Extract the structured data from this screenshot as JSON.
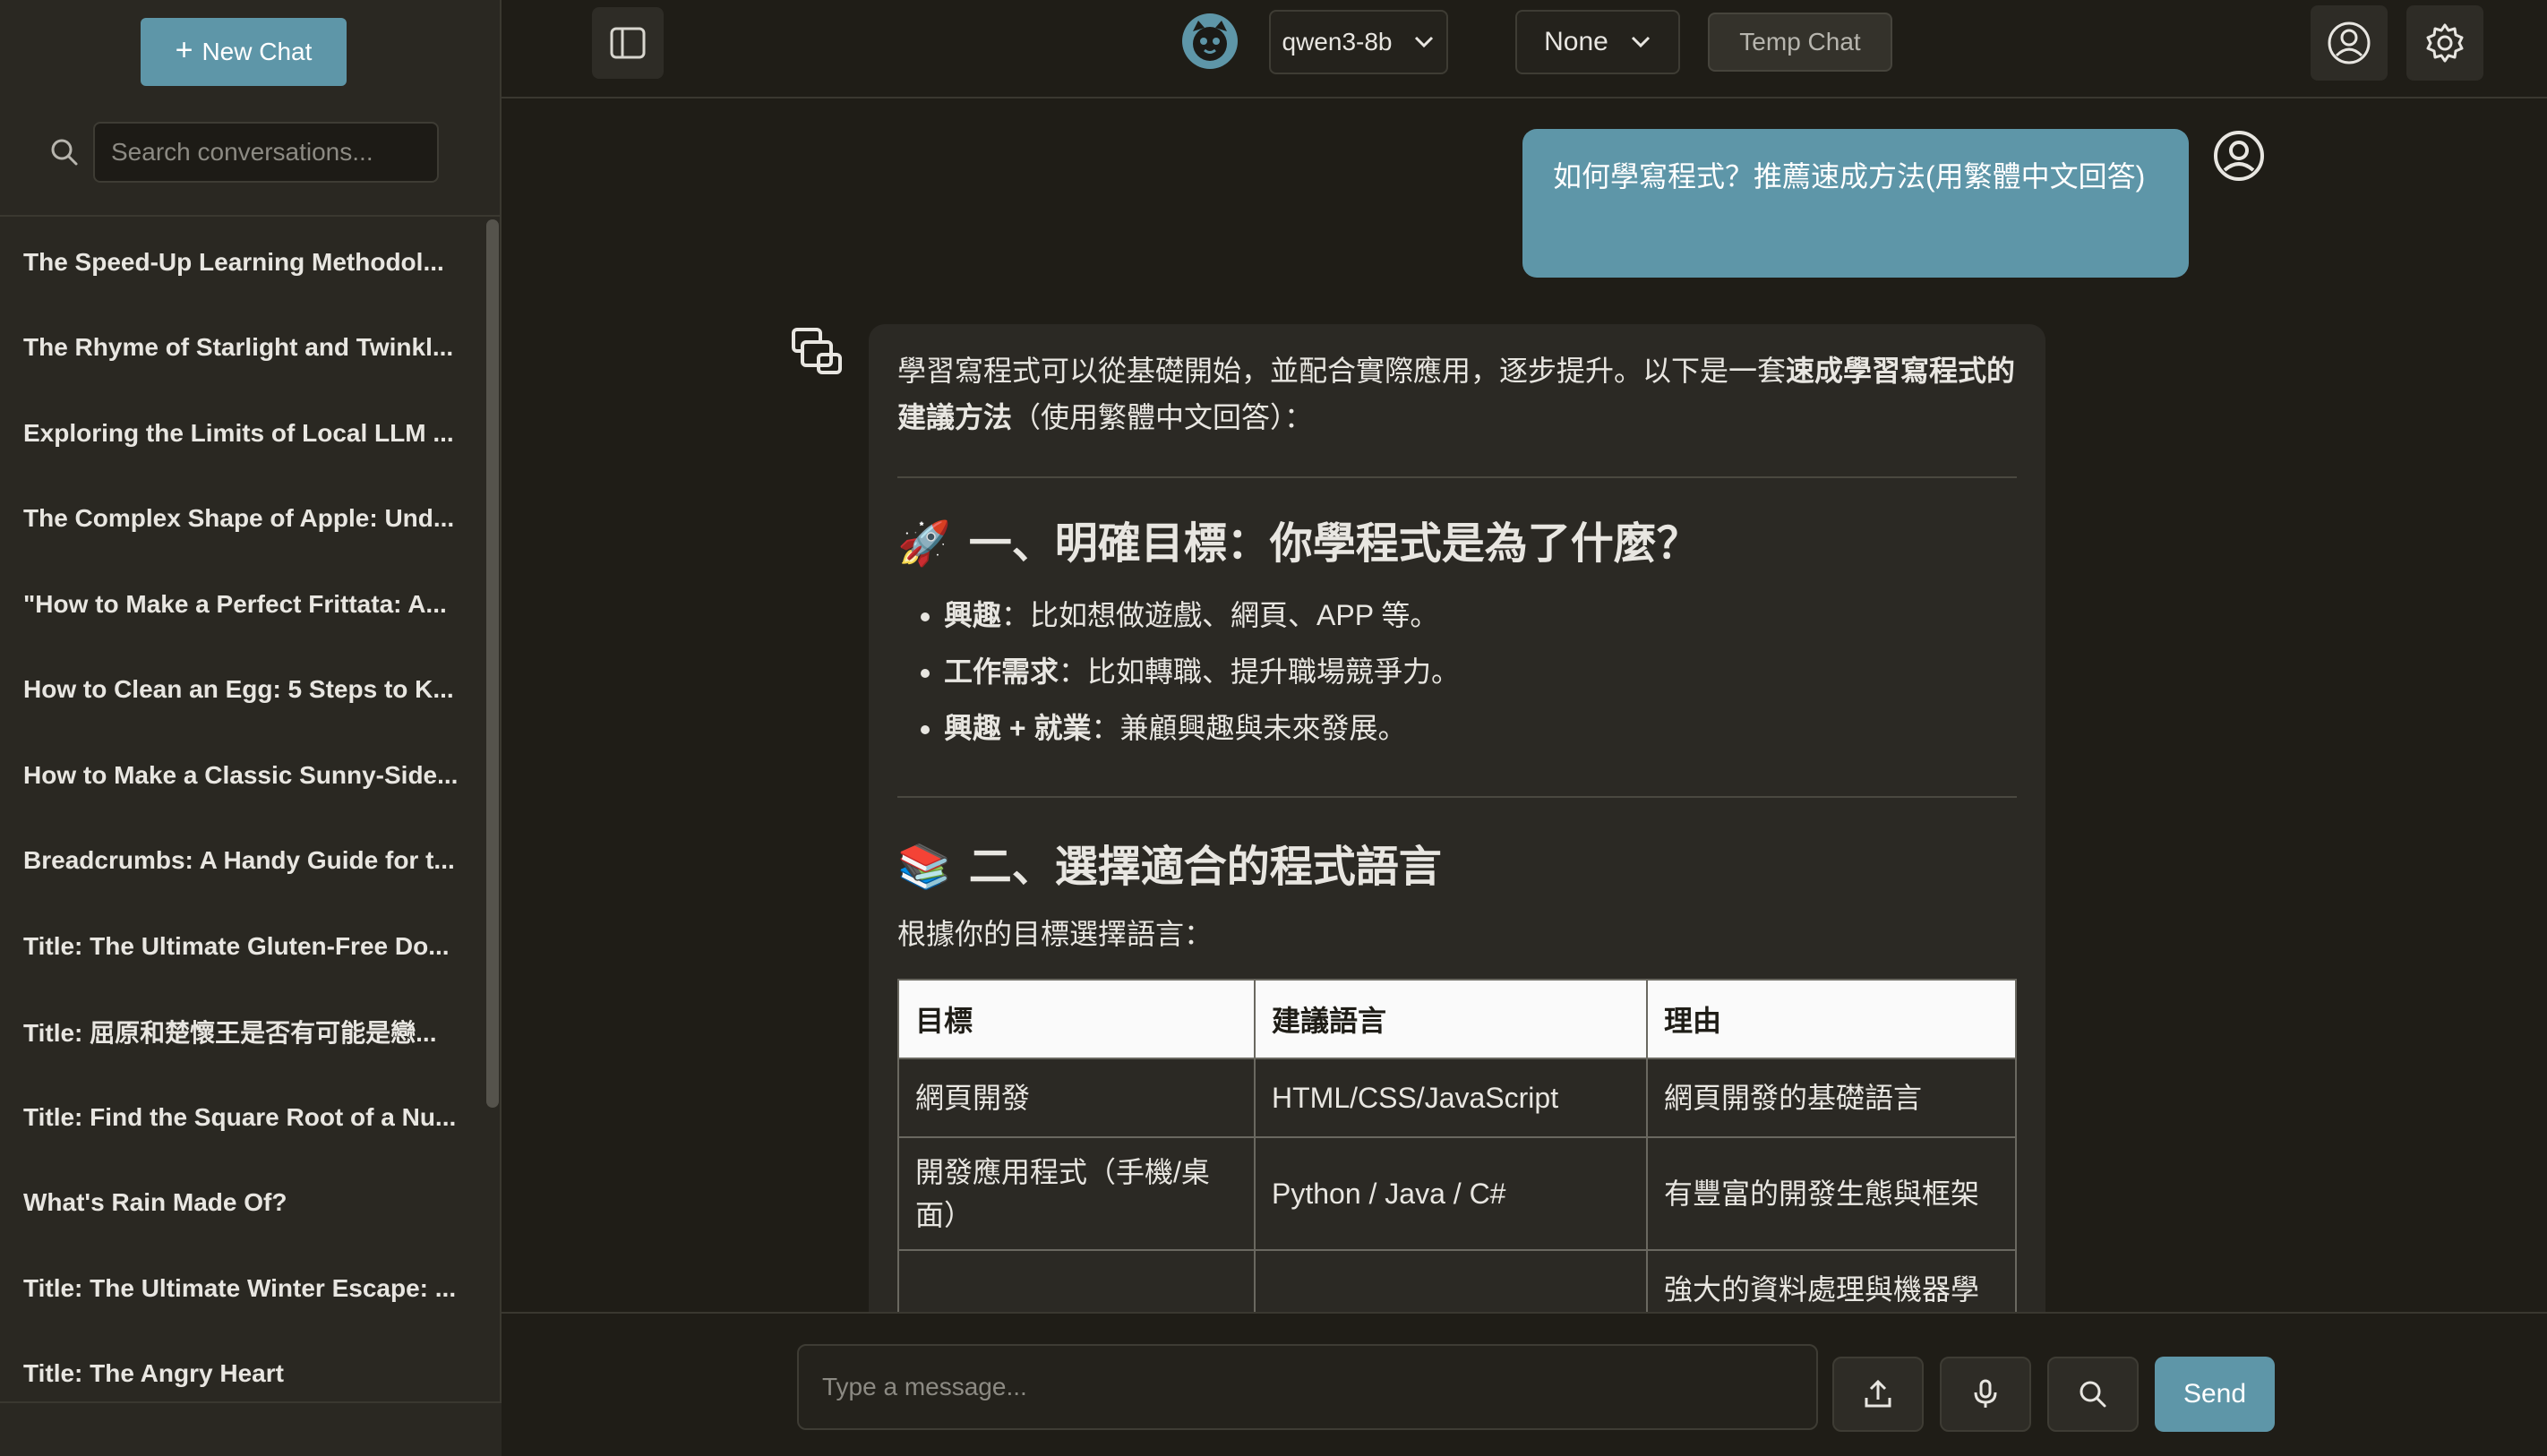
{
  "sidebar": {
    "new_chat_label": "New Chat",
    "search_placeholder": "Search conversations...",
    "conversations": [
      "The Speed-Up Learning Methodol...",
      "The Rhyme of Starlight and Twinkl...",
      "Exploring the Limits of Local LLM ...",
      "The Complex Shape of Apple: Und...",
      "\"How to Make a Perfect Frittata: A...",
      "How to Clean an Egg: 5 Steps to K...",
      "How to Make a Classic Sunny-Side...",
      "Breadcrumbs: A Handy Guide for t...",
      "Title: The Ultimate Gluten-Free Do...",
      "Title: 屈原和楚懷王是否有可能是戀...",
      "Title: Find the Square Root of a Nu...",
      "What's Rain Made Of?",
      "Title: The Ultimate Winter Escape: ...",
      "Title: The Angry Heart"
    ]
  },
  "topbar": {
    "model": "qwen3-8b",
    "preset": "None",
    "temp_chat_label": "Temp Chat"
  },
  "chat": {
    "user_message": "如何學寫程式？推薦速成方法(用繁體中文回答)",
    "intro_plain": "學習寫程式可以從基礎開始，並配合實際應用，逐步提升。以下是一套",
    "intro_bold": "速成學習寫程式的建議方法",
    "intro_suffix": "（使用繁體中文回答）：",
    "section1": {
      "emoji": "🚀",
      "title": "一、明確目標：你學程式是為了什麼？",
      "bullets": [
        {
          "bold": "興趣",
          "text": "：比如想做遊戲、網頁、APP 等。"
        },
        {
          "bold": "工作需求",
          "text": "：比如轉職、提升職場競爭力。"
        },
        {
          "bold": "興趣 + 就業",
          "text": "：兼顧興趣與未來發展。"
        }
      ]
    },
    "section2": {
      "emoji": "📚",
      "title": "二、選擇適合的程式語言",
      "lead": "根據你的目標選擇語言：",
      "table": {
        "headers": [
          "目標",
          "建議語言",
          "理由"
        ],
        "rows": [
          [
            "網頁開發",
            "HTML/CSS/JavaScript",
            "網頁開發的基礎語言"
          ],
          [
            "開發應用程式（手機/桌面）",
            "Python / Java / C#",
            "有豐富的開發生態與框架"
          ],
          [
            "",
            "",
            "強大的資料處理與機器學"
          ]
        ]
      }
    }
  },
  "composer": {
    "placeholder": "Type a message...",
    "send_label": "Send"
  }
}
